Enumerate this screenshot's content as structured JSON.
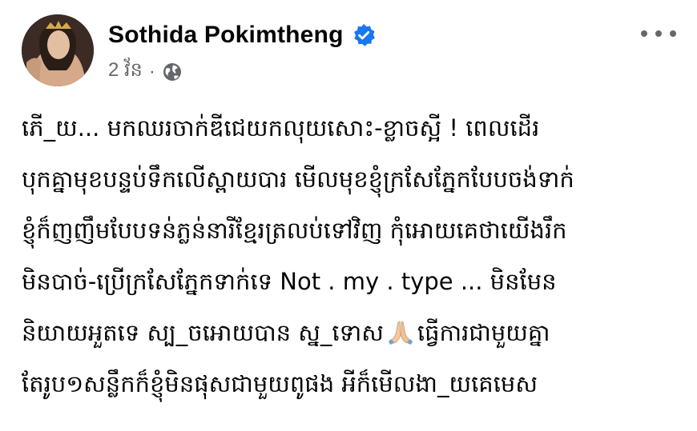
{
  "header": {
    "author_name": "Sothida Pokimtheng",
    "timestamp": "2 វ័ន",
    "separator": "·",
    "verified_icon": "verified-badge-icon",
    "audience_icon": "globe-icon",
    "more_icon": "more-options-icon",
    "accent_color": "#1877f2"
  },
  "post": {
    "lines": [
      "ភើ_យ... មកឈរចាក់ឌីជេយកលុយសោះ-ខ្លាចស្អី ! ពេលដើរ",
      "បុកគ្នាមុខបន្ទប់ទឹកលើស្ពាយបារ មើលមុខខ្ញុំក្រសែភ្នែកបែបចង់ទាក់",
      "ខ្ញុំក៏ញញឹមបែបទន់ភ្លន់នារីខ្មែរត្រលប់ទៅវិញ កុំអោយគេថាយើងរឹក",
      "មិនបាច់-ប្រើក្រសែភ្នែកទាក់ទេ Not . my . type ... មិនមែន",
      "និយាយអួតទេ ស្ប_ចអោយបាន ស្ន_ទោស",
      "ធ្វើការជាមួយគ្នា",
      "តែរូប១សន្លឹកក៏ខ្ញុំមិនផុសជាមួយពូផង អីក៏មើលងា_យគេមេស"
    ],
    "emoji": "folded-hands-emoji"
  }
}
